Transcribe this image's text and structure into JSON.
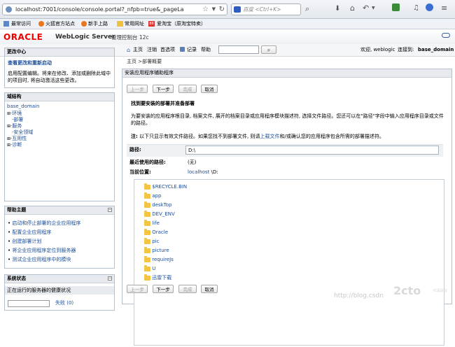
{
  "browser": {
    "url": "localhost:7001/console/console.portal?_nfpb=true&_pageLa",
    "search_placeholder": "百度 <Ctrl+K>",
    "bookmarks": [
      "最常访问",
      "火狐官方站点",
      "新手上路",
      "常用网址",
      "爱淘宝（原淘宝特卖）"
    ]
  },
  "header": {
    "oracle_logo": "ORACLE",
    "product": "WebLogic Server",
    "product_suffix": "管理控制台 12c"
  },
  "toolbar": {
    "links": [
      "主页",
      "注销",
      "首选项",
      "记录",
      "帮助"
    ],
    "welcome": "欢迎, weblogic",
    "connected_label": "连接到:",
    "domain": "base_domain"
  },
  "breadcrumb": "主页 >部署概要",
  "change_center": {
    "title": "更改中心",
    "link": "查看更改和重新启动",
    "text": "启用配置编辑。将来在修改、添加或删除此域中的项目时, 将自动激活这些更改。"
  },
  "domain_structure": {
    "title": "域结构",
    "root": "base_domain",
    "items": [
      "环境",
      "部署",
      "服务",
      "安全领域",
      "互用性",
      "诊断"
    ]
  },
  "help_topics": {
    "title": "帮助主题",
    "items": [
      "启动和停止部署的企业应用程序",
      "配置企业应用程序",
      "创建部署计划",
      "将企业应用程序定位到服务器",
      "测试企业应用程序中的模块"
    ]
  },
  "system_status": {
    "title": "系统状态",
    "subtitle": "正在运行的服务器的健康状况",
    "failed_label": "失败 (0)"
  },
  "main": {
    "panel_title": "安装应用程序辅助程序",
    "buttons": [
      "上一步",
      "下一步",
      "完成",
      "取消"
    ],
    "heading": "找到要安装的部署并准备部署",
    "description": "为要安装的应用程序根目录, 档案文件, 展开的档案目录或应用程序模块描述符, 选择文件路径。您还可以在\"路径\"字段中输入应用程序目录或文件的路径。",
    "note_prefix": "注:",
    "note_text": "以下只显示有效文件路径。如果您找不到部署文件, 则请",
    "note_link": "上载文件",
    "note_text2": "和/或确认您的应用程序包含所需的部署描述符。",
    "path_label": "路径:",
    "path_value": "D:\\",
    "recent_label": "最近使用的路径:",
    "recent_value": "(无)",
    "location_label": "当前位置:",
    "location_host": "localhost",
    "location_dir": "\\D:",
    "folders": [
      "$RECYCLE.BIN",
      "app",
      "deskTop",
      "DEV_ENV",
      "life",
      "Oracle",
      "pic",
      "picture",
      "requireJs",
      "U",
      "迅雷下载"
    ]
  },
  "watermark": {
    "url": "http://blog.csdn",
    "logo": "2cto",
    "logo_sub": "红黑联盟"
  }
}
